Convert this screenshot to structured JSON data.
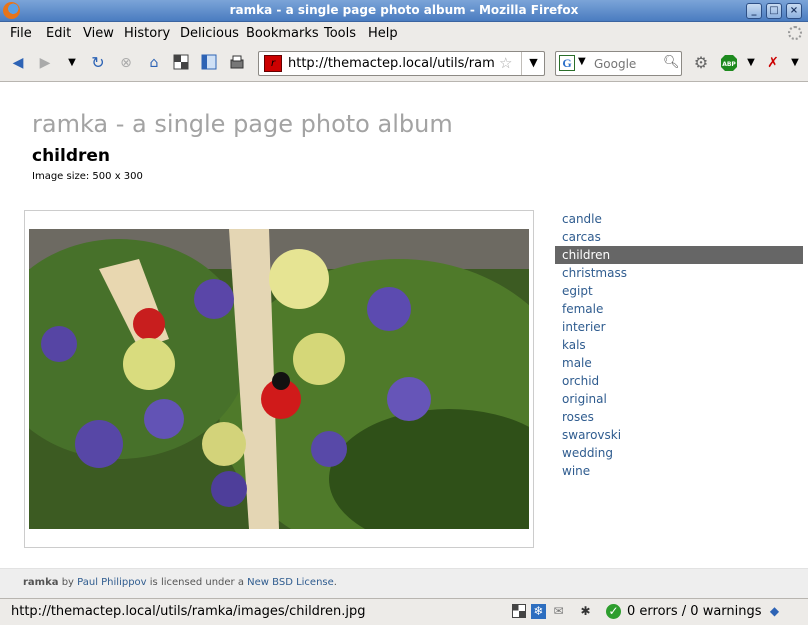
{
  "window": {
    "title": "ramka - a single page photo album - Mozilla Firefox"
  },
  "menu": {
    "items": [
      "File",
      "Edit",
      "View",
      "History",
      "Delicious",
      "Bookmarks",
      "Tools",
      "Help"
    ]
  },
  "navbar": {
    "url": "http://themactep.local/utils/ramka/",
    "favicon_label": "r",
    "search_engine_letter": "G",
    "search_placeholder": "Google",
    "abp_label": "ABP"
  },
  "page": {
    "site_title": "ramka - a single page photo album",
    "album_title": "children",
    "image_size_label": "Image size: 500 x 300",
    "albums": [
      {
        "label": "candle",
        "active": false
      },
      {
        "label": "carcas",
        "active": false
      },
      {
        "label": "children",
        "active": true
      },
      {
        "label": "christmass",
        "active": false
      },
      {
        "label": "egipt",
        "active": false
      },
      {
        "label": "female",
        "active": false
      },
      {
        "label": "interier",
        "active": false
      },
      {
        "label": "kals",
        "active": false
      },
      {
        "label": "male",
        "active": false
      },
      {
        "label": "orchid",
        "active": false
      },
      {
        "label": "original",
        "active": false
      },
      {
        "label": "roses",
        "active": false
      },
      {
        "label": "swarovski",
        "active": false
      },
      {
        "label": "wedding",
        "active": false
      },
      {
        "label": "wine",
        "active": false
      }
    ],
    "footer": {
      "app_name": "ramka",
      "by": "by",
      "author": "Paul Philippov",
      "licensed": "is licensed under a",
      "license": "New BSD License",
      "period": "."
    }
  },
  "statusbar": {
    "text": "http://themactep.local/utils/ramka/images/children.jpg",
    "errors_label": "0 errors / 0 warnings"
  },
  "colors": {
    "link": "#2f5c8f",
    "active_bg": "#666666",
    "site_title": "#a3a3a3",
    "titlebar": "#4a7cc0"
  }
}
